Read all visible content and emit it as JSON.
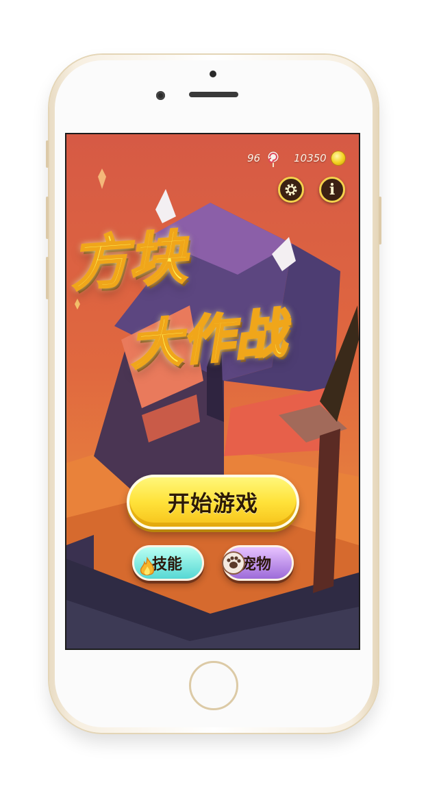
{
  "hud": {
    "lollipops": "96",
    "coins": "10350"
  },
  "title": {
    "line1": "方块",
    "line2": "大作战"
  },
  "buttons": {
    "start": "开始游戏",
    "skills": "技能",
    "pets": "宠物"
  },
  "icons": {
    "settings": "gear-icon",
    "info": "info-icon",
    "currency_a": "lollipop-icon",
    "currency_b": "coin-icon",
    "skills": "flame-icon",
    "pets": "paw-icon"
  },
  "colors": {
    "title_fill": "#fff35a",
    "start_button": "#ffe23a",
    "skills_button": "#56d8d4",
    "pets_button": "#9d6bd9"
  }
}
